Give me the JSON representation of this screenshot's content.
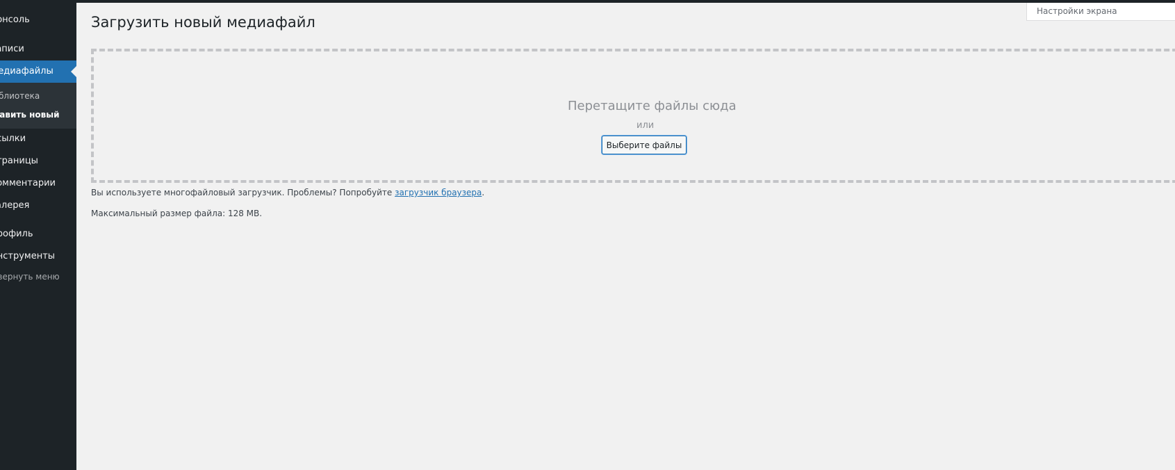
{
  "sidebar": {
    "items": [
      {
        "label": "Консоль"
      },
      {
        "label": "Записи"
      },
      {
        "label": "Медиафайлы"
      },
      {
        "label": "Ссылки"
      },
      {
        "label": "Страницы"
      },
      {
        "label": "Комментарии"
      },
      {
        "label": "Галерея"
      },
      {
        "label": "Профиль"
      },
      {
        "label": "Инструменты"
      }
    ],
    "submenu": [
      {
        "label": "Библиотека"
      },
      {
        "label": "Добавить новый"
      }
    ],
    "collapse_label": "Свернуть меню"
  },
  "header": {
    "screen_options": "Настройки экрана"
  },
  "main": {
    "title": "Загрузить новый медиафайл",
    "dropzone": {
      "drop_text": "Перетащите файлы сюда",
      "or_text": "или",
      "select_button": "Выберите файлы"
    },
    "uploader_info": {
      "text": "Вы используете многофайловый загрузчик. Проблемы? Попробуйте ",
      "link": "загрузчик браузера",
      "suffix": "."
    },
    "max_size": "Максимальный размер файла: 128 MB."
  },
  "colors": {
    "sidebar_bg": "#1d2327",
    "accent": "#2271b1",
    "page_bg": "#f1f1f1"
  }
}
